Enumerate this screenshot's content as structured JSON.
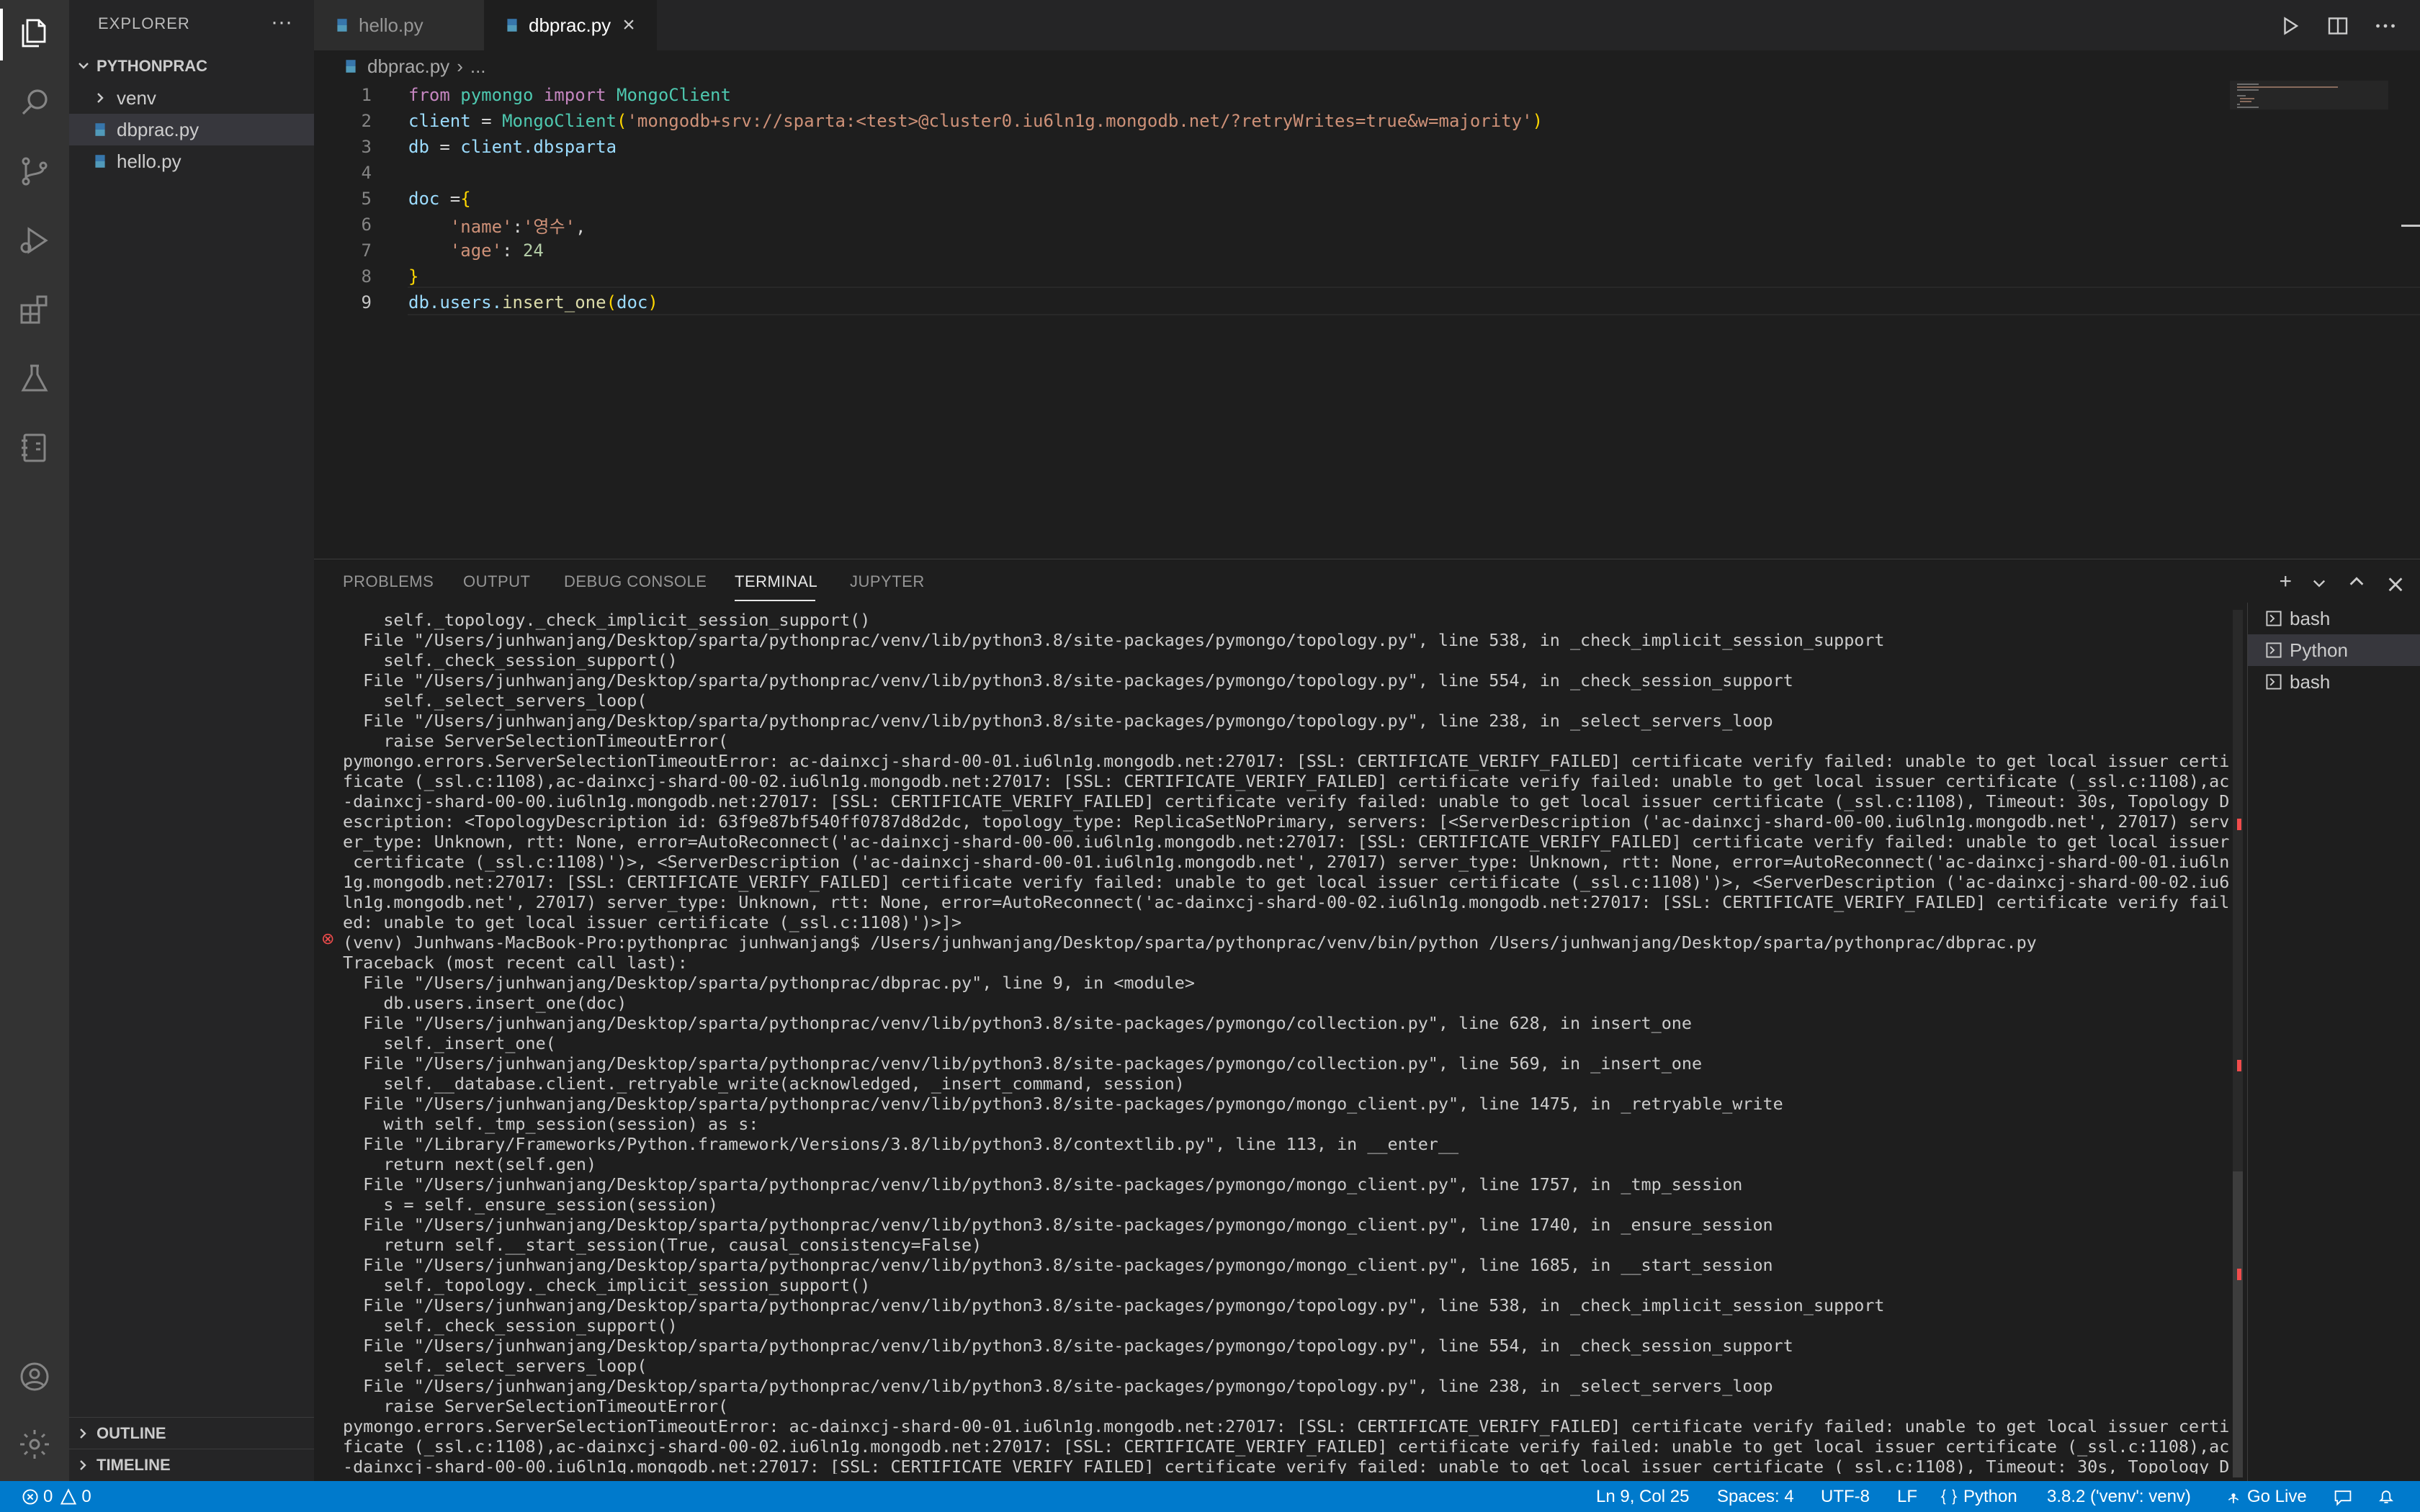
{
  "sidebar": {
    "title": "EXPLORER",
    "more": "···",
    "project": "PYTHONPRAC",
    "items": [
      {
        "label": "venv"
      },
      {
        "label": "dbprac.py"
      },
      {
        "label": "hello.py"
      }
    ],
    "outline": "OUTLINE",
    "timeline": "TIMELINE"
  },
  "tabs": [
    {
      "label": "hello.py"
    },
    {
      "label": "dbprac.py",
      "close": "×"
    }
  ],
  "breadcrumb": {
    "file": "dbprac.py",
    "sep": "›",
    "more": "..."
  },
  "editor": {
    "line_numbers": [
      "1",
      "2",
      "3",
      "4",
      "5",
      "6",
      "7",
      "8",
      "9"
    ],
    "l1": {
      "kw1": "from",
      "mod": "pymongo",
      "kw2": "import",
      "cls": "MongoClient"
    },
    "l2": {
      "var": "client",
      "eq": " = ",
      "cls": "MongoClient",
      "open": "(",
      "str": "'mongodb+srv://sparta:<test>@cluster0.iu6ln1g.mongodb.net/?retryWrites=true&w=majority'",
      "close": ")"
    },
    "l3": {
      "var": "db",
      "eq": " = ",
      "obj": "client",
      "attr": ".dbsparta"
    },
    "l5": {
      "var": "doc",
      "eq": " =",
      "brace": "{"
    },
    "l6": {
      "key": "'name'",
      "colon": ":",
      "val": "'영수'",
      "comma": ","
    },
    "l7": {
      "key": "'age'",
      "colon": ": ",
      "val": "24"
    },
    "l8": {
      "brace": "}"
    },
    "l9": {
      "obj": "db",
      "attr": ".users.",
      "fn": "insert_one",
      "open": "(",
      "arg": "doc",
      "close": ")"
    }
  },
  "panel": {
    "tabs": [
      "PROBLEMS",
      "OUTPUT",
      "DEBUG CONSOLE",
      "TERMINAL",
      "JUPYTER"
    ],
    "active_tab": "TERMINAL",
    "add": "+",
    "terminals": [
      "bash",
      "Python",
      "bash"
    ]
  },
  "terminal_lines": [
    "    self._topology._check_implicit_session_support()",
    "  File \"/Users/junhwanjang/Desktop/sparta/pythonprac/venv/lib/python3.8/site-packages/pymongo/topology.py\", line 538, in _check_implicit_session_support",
    "    self._check_session_support()",
    "  File \"/Users/junhwanjang/Desktop/sparta/pythonprac/venv/lib/python3.8/site-packages/pymongo/topology.py\", line 554, in _check_session_support",
    "    self._select_servers_loop(",
    "  File \"/Users/junhwanjang/Desktop/sparta/pythonprac/venv/lib/python3.8/site-packages/pymongo/topology.py\", line 238, in _select_servers_loop",
    "    raise ServerSelectionTimeoutError(",
    "pymongo.errors.ServerSelectionTimeoutError: ac-dainxcj-shard-00-01.iu6ln1g.mongodb.net:27017: [SSL: CERTIFICATE_VERIFY_FAILED] certificate verify failed: unable to get local issuer certi",
    "ficate (_ssl.c:1108),ac-dainxcj-shard-00-02.iu6ln1g.mongodb.net:27017: [SSL: CERTIFICATE_VERIFY_FAILED] certificate verify failed: unable to get local issuer certificate (_ssl.c:1108),ac",
    "-dainxcj-shard-00-00.iu6ln1g.mongodb.net:27017: [SSL: CERTIFICATE_VERIFY_FAILED] certificate verify failed: unable to get local issuer certificate (_ssl.c:1108), Timeout: 30s, Topology D",
    "escription: <TopologyDescription id: 63f9e87bf540ff0787d8d2dc, topology_type: ReplicaSetNoPrimary, servers: [<ServerDescription ('ac-dainxcj-shard-00-00.iu6ln1g.mongodb.net', 27017) serv",
    "er_type: Unknown, rtt: None, error=AutoReconnect('ac-dainxcj-shard-00-00.iu6ln1g.mongodb.net:27017: [SSL: CERTIFICATE_VERIFY_FAILED] certificate verify failed: unable to get local issuer",
    " certificate (_ssl.c:1108)')>, <ServerDescription ('ac-dainxcj-shard-00-01.iu6ln1g.mongodb.net', 27017) server_type: Unknown, rtt: None, error=AutoReconnect('ac-dainxcj-shard-00-01.iu6ln",
    "1g.mongodb.net:27017: [SSL: CERTIFICATE_VERIFY_FAILED] certificate verify failed: unable to get local issuer certificate (_ssl.c:1108)')>, <ServerDescription ('ac-dainxcj-shard-00-02.iu6",
    "ln1g.mongodb.net', 27017) server_type: Unknown, rtt: None, error=AutoReconnect('ac-dainxcj-shard-00-02.iu6ln1g.mongodb.net:27017: [SSL: CERTIFICATE_VERIFY_FAILED] certificate verify fail",
    "ed: unable to get local issuer certificate (_ssl.c:1108)')>]>",
    "(venv) Junhwans-MacBook-Pro:pythonprac junhwanjang$ /Users/junhwanjang/Desktop/sparta/pythonprac/venv/bin/python /Users/junhwanjang/Desktop/sparta/pythonprac/dbprac.py",
    "Traceback (most recent call last):",
    "  File \"/Users/junhwanjang/Desktop/sparta/pythonprac/dbprac.py\", line 9, in <module>",
    "    db.users.insert_one(doc)",
    "  File \"/Users/junhwanjang/Desktop/sparta/pythonprac/venv/lib/python3.8/site-packages/pymongo/collection.py\", line 628, in insert_one",
    "    self._insert_one(",
    "  File \"/Users/junhwanjang/Desktop/sparta/pythonprac/venv/lib/python3.8/site-packages/pymongo/collection.py\", line 569, in _insert_one",
    "    self.__database.client._retryable_write(acknowledged, _insert_command, session)",
    "  File \"/Users/junhwanjang/Desktop/sparta/pythonprac/venv/lib/python3.8/site-packages/pymongo/mongo_client.py\", line 1475, in _retryable_write",
    "    with self._tmp_session(session) as s:",
    "  File \"/Library/Frameworks/Python.framework/Versions/3.8/lib/python3.8/contextlib.py\", line 113, in __enter__",
    "    return next(self.gen)",
    "  File \"/Users/junhwanjang/Desktop/sparta/pythonprac/venv/lib/python3.8/site-packages/pymongo/mongo_client.py\", line 1757, in _tmp_session",
    "    s = self._ensure_session(session)",
    "  File \"/Users/junhwanjang/Desktop/sparta/pythonprac/venv/lib/python3.8/site-packages/pymongo/mongo_client.py\", line 1740, in _ensure_session",
    "    return self.__start_session(True, causal_consistency=False)",
    "  File \"/Users/junhwanjang/Desktop/sparta/pythonprac/venv/lib/python3.8/site-packages/pymongo/mongo_client.py\", line 1685, in __start_session",
    "    self._topology._check_implicit_session_support()",
    "  File \"/Users/junhwanjang/Desktop/sparta/pythonprac/venv/lib/python3.8/site-packages/pymongo/topology.py\", line 538, in _check_implicit_session_support",
    "    self._check_session_support()",
    "  File \"/Users/junhwanjang/Desktop/sparta/pythonprac/venv/lib/python3.8/site-packages/pymongo/topology.py\", line 554, in _check_session_support",
    "    self._select_servers_loop(",
    "  File \"/Users/junhwanjang/Desktop/sparta/pythonprac/venv/lib/python3.8/site-packages/pymongo/topology.py\", line 238, in _select_servers_loop",
    "    raise ServerSelectionTimeoutError(",
    "pymongo.errors.ServerSelectionTimeoutError: ac-dainxcj-shard-00-01.iu6ln1g.mongodb.net:27017: [SSL: CERTIFICATE_VERIFY_FAILED] certificate verify failed: unable to get local issuer certi",
    "ficate (_ssl.c:1108),ac-dainxcj-shard-00-02.iu6ln1g.mongodb.net:27017: [SSL: CERTIFICATE_VERIFY_FAILED] certificate verify failed: unable to get local issuer certificate (_ssl.c:1108),ac",
    "-dainxcj-shard-00-00.iu6ln1g.mongodb.net:27017: [SSL: CERTIFICATE_VERIFY_FAILED] certificate verify failed: unable to get local issuer certificate (_ssl.c:1108), Timeout: 30s, Topology D"
  ],
  "error_marker": "⊗",
  "statusbar": {
    "errors": "0",
    "warnings": "0",
    "position": "Ln 9, Col 25",
    "spaces": "Spaces: 4",
    "encoding": "UTF-8",
    "eol": "LF",
    "language": "Python",
    "interpreter": "3.8.2 ('venv': venv)",
    "golive": "Go Live"
  }
}
